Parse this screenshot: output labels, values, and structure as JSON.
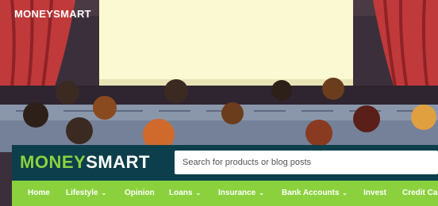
{
  "hero": {
    "logo_text": "MONEYSMART",
    "colors": {
      "curtain": "#c0393b",
      "screen": "#fbf9d2",
      "wall": "#3a2f3a",
      "seats": "#8a97ab"
    }
  },
  "header": {
    "logo_part1": "MONEY",
    "logo_part2": "SMART",
    "search_placeholder": "Search for products or blog posts",
    "colors": {
      "background": "#0c3f4b",
      "accent": "#8bd13e"
    }
  },
  "nav": {
    "items": [
      {
        "label": "Home",
        "has_dropdown": false
      },
      {
        "label": "Lifestyle",
        "has_dropdown": true
      },
      {
        "label": "Opinion",
        "has_dropdown": false
      },
      {
        "label": "Loans",
        "has_dropdown": true
      },
      {
        "label": "Insurance",
        "has_dropdown": true
      },
      {
        "label": "Bank Accounts",
        "has_dropdown": true
      },
      {
        "label": "Invest",
        "has_dropdown": false
      },
      {
        "label": "Credit Ca",
        "has_dropdown": false
      }
    ],
    "dropdown_icon": "chevron-down-icon",
    "background": "#8bd13e"
  }
}
